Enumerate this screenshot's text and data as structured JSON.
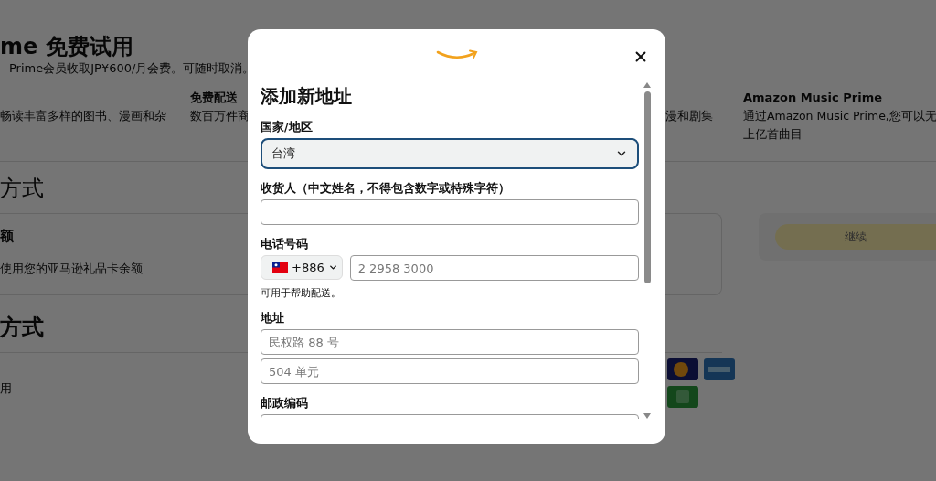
{
  "background_page": {
    "title": "me 免费试用",
    "subtitle": "Prime会员收取JP¥600/月会费。可随时取消。",
    "benefits": [
      {
        "lines": [
          "畅读丰富多样的图书、漫画和杂"
        ]
      },
      {
        "title": "免费配送",
        "lines": [
          "数百万件商"
        ]
      },
      {
        "lines": [
          "漫和剧集"
        ]
      },
      {
        "title": "Amazon Music Prime",
        "lines": [
          "通过Amazon Music Prime,您可以无",
          "上亿首曲目"
        ]
      }
    ],
    "section_1": {
      "heading": "方式",
      "card_title": "额",
      "card_text": "使用您的亚马逊礼品卡余额",
      "button": "继续"
    },
    "section_2": {
      "heading": "方式",
      "row_text": "用"
    }
  },
  "modal": {
    "title": "添加新地址",
    "fields": [
      {
        "kind": "select",
        "label": "国家/地区",
        "value": "台湾",
        "focused": true
      },
      {
        "kind": "text",
        "label": "收货人（中文姓名，不得包含数字或特殊字符）",
        "focused": false
      },
      {
        "kind": "phone",
        "label": "电话号码",
        "code": "+886",
        "placeholder": "2 2958 3000",
        "hint": "可用于帮助配送。",
        "focused": false
      },
      {
        "kind": "text",
        "label": "地址",
        "placeholder": "民权路 88 号",
        "focused": false
      },
      {
        "kind": "text",
        "placeholder": "504 单元",
        "focused": false
      },
      {
        "kind": "text",
        "label": "邮政编码",
        "focused": false
      }
    ]
  }
}
